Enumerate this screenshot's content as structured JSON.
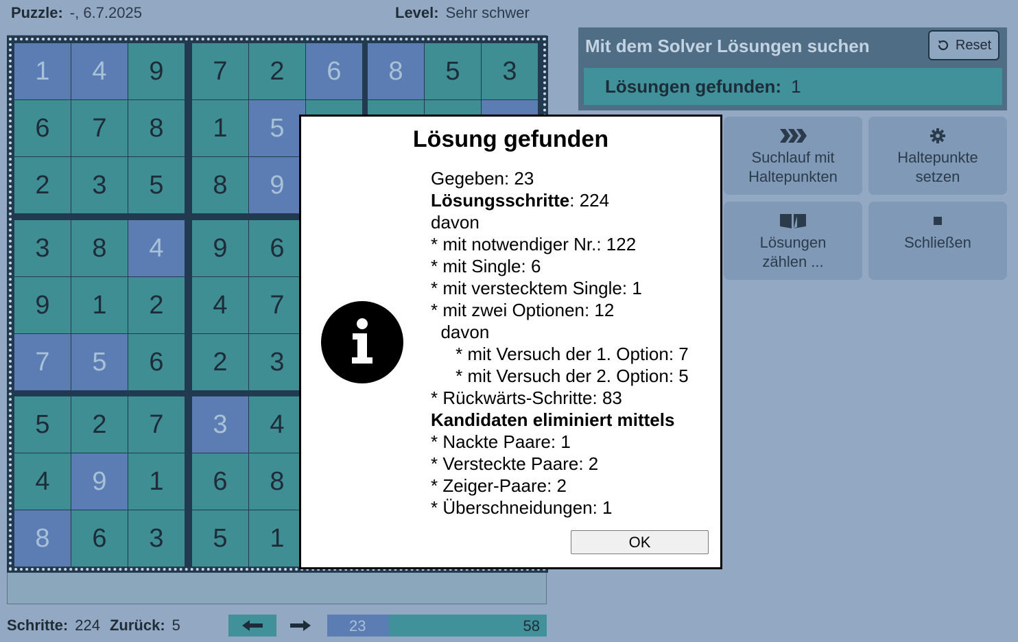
{
  "header": {
    "puzzle_label": "Puzzle:",
    "puzzle_value": "-,  6.7.2025",
    "level_label": "Level:",
    "level_value": "Sehr schwer"
  },
  "grid": {
    "rows": [
      [
        "1",
        "4",
        "9",
        "7",
        "2",
        "6",
        "8",
        "5",
        "3"
      ],
      [
        "6",
        "7",
        "8",
        "1",
        "5",
        "",
        "",
        "",
        ""
      ],
      [
        "2",
        "3",
        "5",
        "8",
        "9",
        "",
        "",
        "",
        ""
      ],
      [
        "3",
        "8",
        "4",
        "9",
        "6",
        "",
        "",
        "",
        ""
      ],
      [
        "9",
        "1",
        "2",
        "4",
        "7",
        "",
        "",
        "",
        ""
      ],
      [
        "7",
        "5",
        "6",
        "2",
        "3",
        "",
        "",
        "",
        ""
      ],
      [
        "5",
        "2",
        "7",
        "3",
        "4",
        "",
        "",
        "",
        ""
      ],
      [
        "4",
        "9",
        "1",
        "6",
        "8",
        "",
        "",
        "",
        ""
      ],
      [
        "8",
        "6",
        "3",
        "5",
        "1",
        "",
        "",
        "",
        ""
      ]
    ],
    "given": [
      [
        1,
        1,
        0,
        0,
        0,
        1,
        1,
        0,
        0
      ],
      [
        0,
        0,
        0,
        0,
        1,
        0,
        0,
        0,
        1
      ],
      [
        0,
        0,
        0,
        0,
        1,
        0,
        0,
        0,
        0
      ],
      [
        0,
        0,
        1,
        0,
        0,
        0,
        0,
        0,
        0
      ],
      [
        0,
        0,
        0,
        0,
        0,
        0,
        0,
        0,
        0
      ],
      [
        1,
        1,
        0,
        0,
        0,
        0,
        0,
        0,
        0
      ],
      [
        0,
        0,
        0,
        1,
        0,
        0,
        0,
        0,
        0
      ],
      [
        0,
        1,
        0,
        0,
        0,
        0,
        0,
        0,
        0
      ],
      [
        1,
        0,
        0,
        0,
        0,
        0,
        0,
        0,
        0
      ]
    ]
  },
  "solver": {
    "title": "Mit dem Solver Lösungen suchen",
    "reset_label": "Reset",
    "solutions_label": "Lösungen gefunden:",
    "solutions_value": "1"
  },
  "tools": {
    "search_line1": "Suchlauf mit",
    "search_line2": "Haltepunkten",
    "breakpoints_line1": "Haltepunkte",
    "breakpoints_line2": "setzen",
    "count_line1": "Lösungen",
    "count_line2": "zählen ...",
    "close_label": "Schließen"
  },
  "bottom": {
    "steps_label": "Schritte:",
    "steps_value": "224",
    "back_label": "Zurück:",
    "back_value": "5",
    "progress_left": "23",
    "progress_right": "58",
    "progress_fraction": 0.28
  },
  "dialog": {
    "title": "Lösung gefunden",
    "lines": [
      {
        "text": "Gegeben: 23",
        "bold": ""
      },
      {
        "text": ": 224",
        "bold": "Lösungsschritte"
      },
      {
        "text": "davon",
        "bold": ""
      },
      {
        "text": "* mit notwendiger Nr.: 122",
        "bold": ""
      },
      {
        "text": "* mit Single: 6",
        "bold": ""
      },
      {
        "text": "* mit verstecktem Single: 1",
        "bold": ""
      },
      {
        "text": "* mit zwei Optionen: 12",
        "bold": ""
      },
      {
        "text": "  davon",
        "bold": ""
      },
      {
        "text": "     * mit Versuch der 1. Option: 7",
        "bold": ""
      },
      {
        "text": "     * mit Versuch der 2. Option: 5",
        "bold": ""
      },
      {
        "text": "* Rückwärts-Schritte: 83",
        "bold": ""
      },
      {
        "text": "",
        "bold": "Kandidaten eliminiert mittels"
      },
      {
        "text": "* Nackte Paare: 1",
        "bold": ""
      },
      {
        "text": "* Versteckte Paare: 2",
        "bold": ""
      },
      {
        "text": "* Zeiger-Paare: 2",
        "bold": ""
      },
      {
        "text": "* Überschneidungen: 1",
        "bold": ""
      }
    ],
    "ok_label": "OK"
  }
}
